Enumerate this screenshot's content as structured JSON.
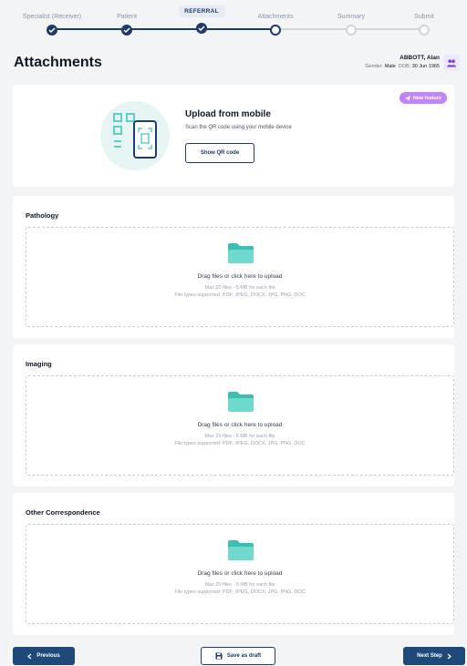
{
  "stepper": {
    "steps": [
      {
        "label": "Specialist (Receiver)",
        "state": "done"
      },
      {
        "label": "Patient",
        "state": "done"
      },
      {
        "label": "REFERRAL",
        "state": "done"
      },
      {
        "label": "Attachments",
        "state": "active"
      },
      {
        "label": "Summary",
        "state": "todo"
      },
      {
        "label": "Submit",
        "state": "todo"
      }
    ]
  },
  "header": {
    "title": "Attachments",
    "patient_name": "ABBOTT, Alan",
    "gender_label": "Gender:",
    "gender_value": "Male",
    "dob_label": "DOB:",
    "dob_value": "30 Jun 1965",
    "people_icon": "people-icon"
  },
  "qr": {
    "badge": "New feature",
    "title": "Upload from mobile",
    "subtitle": "Scan the QR code using your mobile device",
    "button": "Show QR code"
  },
  "sections": [
    {
      "title": "Pathology",
      "main": "Drag files or click here to upload",
      "limit": "Max 20 files - 5 MB for each file",
      "types": "File types supported: PDF, JPEG, DOCX, JPG, PNG, DOC"
    },
    {
      "title": "Imaging",
      "main": "Drag files or click here to upload",
      "limit": "Max 20 files - 5 MB for each file",
      "types": "File types supported: PDF, JPEG, DOCX, JPG, PNG, DOC"
    },
    {
      "title": "Other Correspondence",
      "main": "Drag files or click here to upload",
      "limit": "Max 20 files - 5 MB for each file",
      "types": "File types supported: PDF, JPEG, DOCX, JPG, PNG, DOC"
    }
  ],
  "footer": {
    "previous": "Previous",
    "save_draft": "Save as draft",
    "next": "Next Step"
  },
  "colors": {
    "primary": "#1e3a6e",
    "teal": "#5fcfc4",
    "badge": "#c084fc"
  }
}
